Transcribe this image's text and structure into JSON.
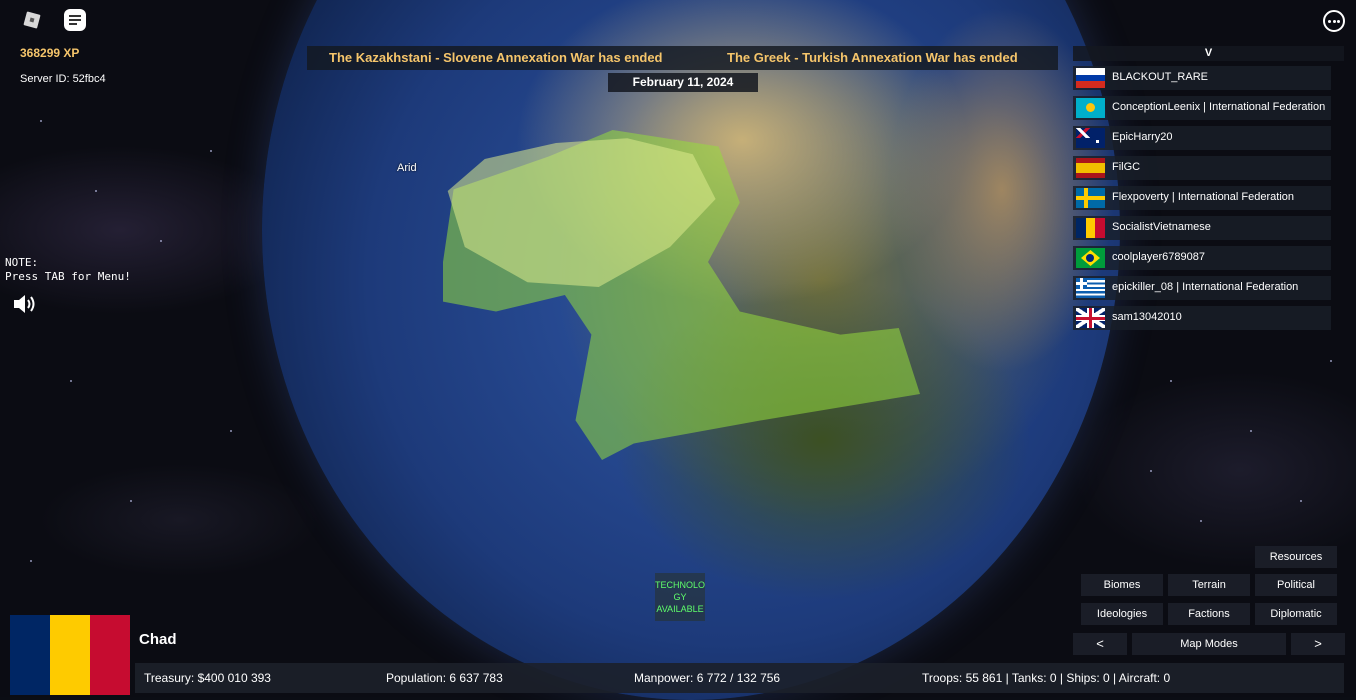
{
  "hud": {
    "xp": "368299 XP",
    "server_id": "Server ID: 52fbc4",
    "note": "NOTE:\nPress TAB for Menu!"
  },
  "news": {
    "items": [
      "The Kazakhstani - Slovene Annexation War has ended",
      "The Greek - Turkish Annexation War has ended"
    ],
    "date": "February 11, 2024"
  },
  "map": {
    "biome_label": "Arid",
    "technology_badge": "TECHNOLO\nGY\nAVAILABLE",
    "highlight_color": "#96dc3c"
  },
  "player_list": {
    "toggle_label": "V",
    "players": [
      {
        "name": "BLACKOUT_RARE",
        "flag": "russia"
      },
      {
        "name": "ConceptionLeenix  |  International Federation",
        "flag": "kazakhstan"
      },
      {
        "name": "EpicHarry20",
        "flag": "australia"
      },
      {
        "name": "FilGC",
        "flag": "spain"
      },
      {
        "name": "Flexpoverty  |  International Federation",
        "flag": "sweden"
      },
      {
        "name": "SocialistVietnamese",
        "flag": "chad"
      },
      {
        "name": "coolplayer6789087",
        "flag": "brazil"
      },
      {
        "name": "epickiller_08  |  International Federation",
        "flag": "greece"
      },
      {
        "name": "sam13042010",
        "flag": "uk"
      }
    ]
  },
  "map_modes": {
    "resources": "Resources",
    "biomes": "Biomes",
    "terrain": "Terrain",
    "political": "Political",
    "ideologies": "Ideologies",
    "factions": "Factions",
    "diplomatic": "Diplomatic",
    "prev": "<",
    "label": "Map Modes",
    "next": ">"
  },
  "country": {
    "name": "Chad",
    "flag_colors": [
      "#002664",
      "#fecb00",
      "#c60c30"
    ],
    "treasury": "Treasury:   $400 010 393",
    "population": "Population: 6 637 783",
    "manpower": "Manpower:   6 772  /  132 756",
    "military": "Troops: 55 861  |  Tanks: 0  |  Ships: 0  |  Aircraft: 0"
  }
}
